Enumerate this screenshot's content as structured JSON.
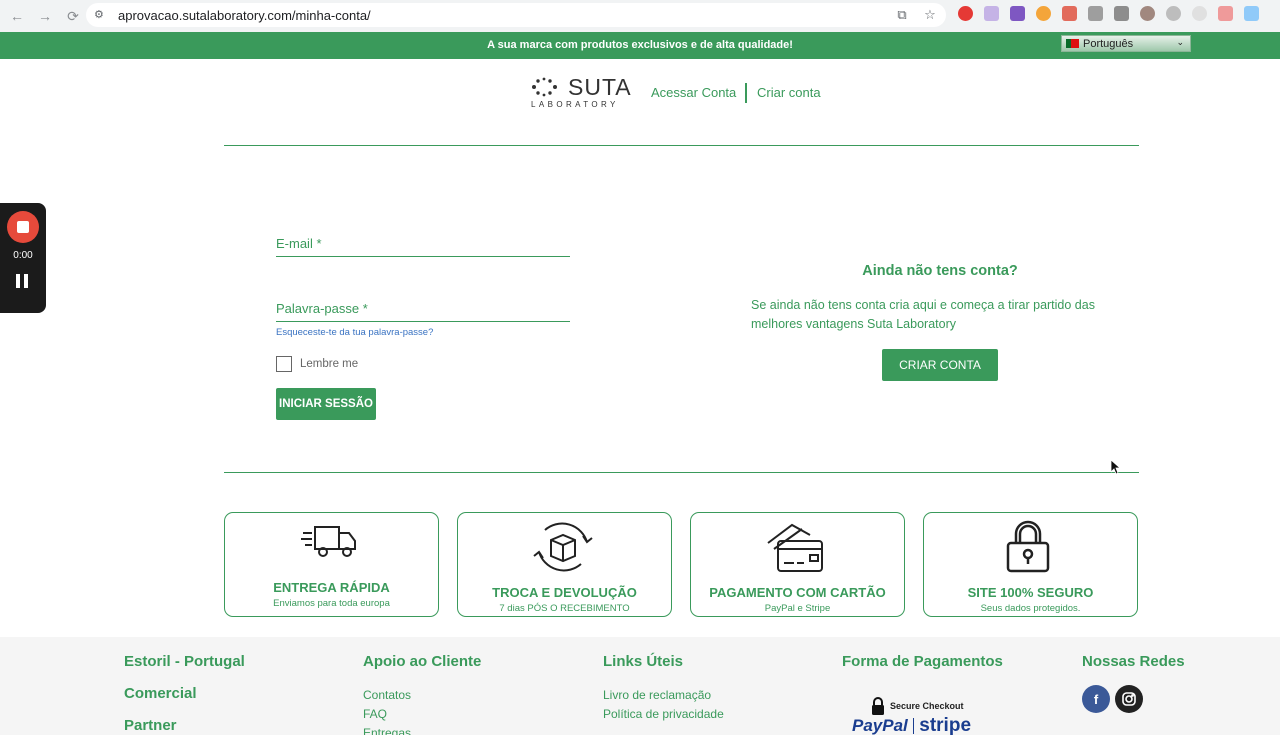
{
  "browser": {
    "url": "aprovacao.sutalaboratory.com/minha-conta/"
  },
  "banner": {
    "text": "A sua marca com produtos exclusivos e de alta qualidade!",
    "language": "Português"
  },
  "header": {
    "logo_main": "SUTA",
    "logo_sub": "LABORATORY",
    "login_link": "Acessar Conta",
    "register_link": "Criar conta"
  },
  "login": {
    "email_placeholder": "E-mail *",
    "password_placeholder": "Palavra-passe *",
    "forgot_password": "Esqueceste-te da tua palavra-passe?",
    "remember_me": "Lembre me",
    "submit": "INICIAR SESSÃO"
  },
  "register": {
    "title": "Ainda não tens conta?",
    "text": "Se ainda não tens conta cria aqui e começa a tirar partido das melhores vantagens Suta Laboratory",
    "button": "CRIAR CONTA"
  },
  "features": [
    {
      "icon": "truck-icon",
      "title": "ENTREGA RÁPIDA",
      "subtitle": "Enviamos para toda europa"
    },
    {
      "icon": "return-box-icon",
      "title": "TROCA E DEVOLUÇÃO",
      "subtitle": "7 dias PÓS O RECEBIMENTO"
    },
    {
      "icon": "credit-card-icon",
      "title": "PAGAMENTO COM CARTÃO",
      "subtitle": "PayPal e Stripe"
    },
    {
      "icon": "padlock-icon",
      "title": "SITE 100% SEGURO",
      "subtitle": "Seus dados protegidos."
    }
  ],
  "footer": {
    "col1": [
      "Estoril - Portugal",
      "Comercial",
      "Partner"
    ],
    "support_title": "Apoio ao Cliente",
    "support_links": [
      "Contatos",
      "FAQ",
      "Entregas"
    ],
    "links_title": "Links Úteis",
    "useful_links": [
      "Livro de reclamação",
      "Política de privacidade"
    ],
    "payment_title": "Forma de Pagamentos",
    "secure_checkout": "Secure Checkout",
    "paypal": "PayPal",
    "stripe": "stripe",
    "social_title": "Nossas Redes",
    "social_facebook": "f"
  },
  "recorder": {
    "time": "0:00"
  },
  "colors": {
    "brand_green": "#3a9a5b",
    "link_blue": "#3a73c2",
    "record_red": "#e64a3b"
  }
}
